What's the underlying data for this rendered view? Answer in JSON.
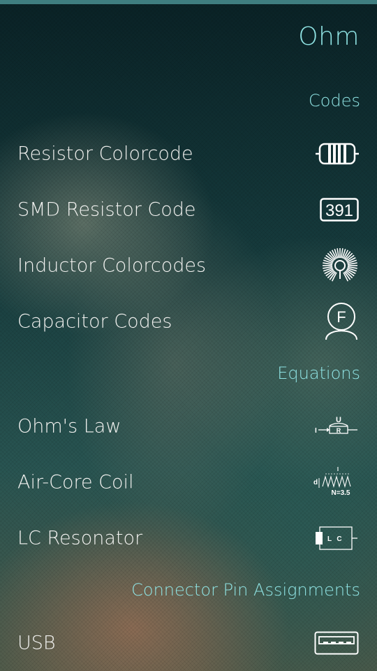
{
  "header": {
    "title": "Ohm"
  },
  "sections": [
    {
      "title": "Codes",
      "items": [
        {
          "label": "Resistor Colorcode",
          "icon": "resistor-icon"
        },
        {
          "label": "SMD Resistor Code",
          "icon": "smd-code-icon",
          "icon_text": "391"
        },
        {
          "label": "Inductor Colorcodes",
          "icon": "inductor-coil-icon"
        },
        {
          "label": "Capacitor Codes",
          "icon": "capacitor-farad-icon",
          "icon_text": "F"
        }
      ]
    },
    {
      "title": "Equations",
      "items": [
        {
          "label": "Ohm's Law",
          "icon": "ohms-law-circuit-icon",
          "icon_text_u": "U",
          "icon_text_i": "I",
          "icon_text_r": "R"
        },
        {
          "label": "Air-Core Coil",
          "icon": "coil-parameters-icon",
          "icon_text_d": "d",
          "icon_text_l": "l",
          "icon_text_n": "N=3.5"
        },
        {
          "label": "LC Resonator",
          "icon": "lc-circuit-icon",
          "icon_text_l": "L",
          "icon_text_c": "C"
        }
      ]
    },
    {
      "title": "Connector Pin Assignments",
      "items": [
        {
          "label": "USB",
          "icon": "usb-connector-icon"
        }
      ]
    }
  ],
  "colors": {
    "accent": "#8fe3e3",
    "text": "#f2f2f0",
    "topbar": "#3f7e80"
  }
}
